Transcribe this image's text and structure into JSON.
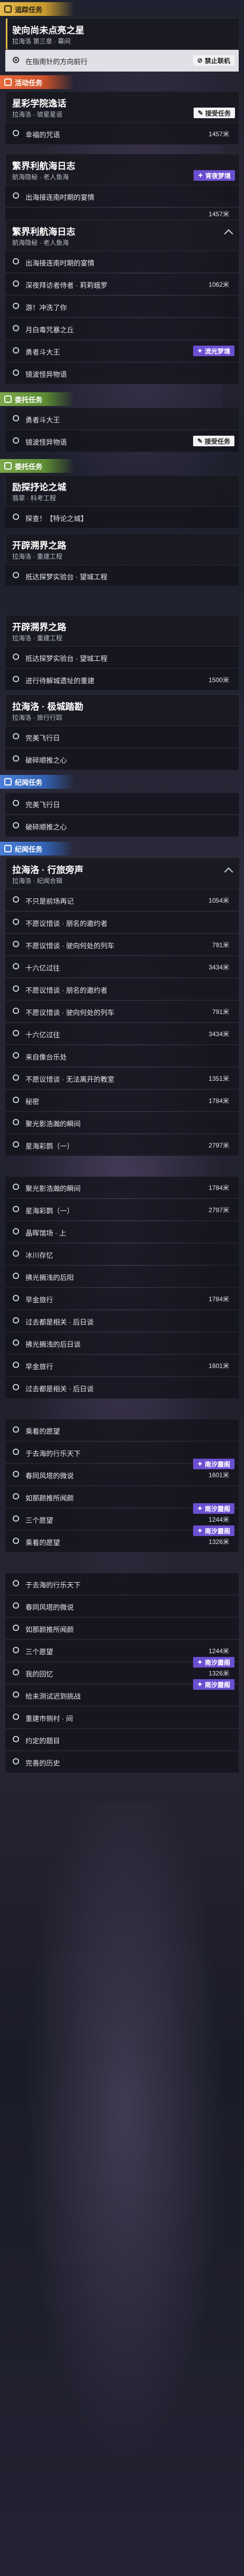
{
  "sections": {
    "tracking": "追踪任务",
    "activity": "活动任务",
    "daily": "委托任务",
    "side": "纪闻任务"
  },
  "badges": {
    "no_coop": "禁止联机",
    "dream_scene": "流光梦境",
    "start_quest": "接受任务",
    "sea_dream": "宵夜梦境",
    "wave": "南汐蜃阁"
  },
  "quests": {
    "q1": {
      "title": "驶向尚未点亮之星",
      "sub": "拉海洛 第三章 · 幕间",
      "steps": [
        "在指南针的方向前行"
      ]
    },
    "q2": {
      "title": "星彩学院逸话",
      "sub": "拉海洛 · 琥星星谣",
      "steps": [
        "幸福的咒语"
      ],
      "dist": [
        "1457米"
      ]
    },
    "q3": {
      "title": "繁界利航海日志",
      "sub": "航海隐秘 · 老人鱼海",
      "steps": [
        "出海接连南时期的宴情"
      ],
      "dist2": "1457米"
    },
    "q4": {
      "title": "繁界利航海日志",
      "sub": "航海隐秘 · 老人鱼海",
      "steps": [
        "出海接连南时期的宴情",
        "深夜拜访者侍者 · 莉莉蛾罗",
        "游！冲洗了你",
        "月白毒咒暴之丘",
        "勇者斗大王",
        "镜波怪异物语"
      ],
      "dist": "1062米"
    },
    "q5": {
      "title": "勇者斗大王",
      "steps2": "镜波怪异物语"
    },
    "q6": {
      "title": "励探抒论之城",
      "sub": "翡翠 · 科考工程",
      "steps": [
        "探查！【特论之城】"
      ]
    },
    "q7": {
      "title": "开辟溯界之路",
      "sub": "拉海洛 · 重建工程",
      "steps": [
        "抵达探梦实验台 · 望城工程"
      ]
    },
    "q8": {
      "title": "开辟溯界之路",
      "sub": "拉海洛 · 重建工程",
      "steps": [
        "抵达探梦实验台 · 望城工程",
        "进行待解城遗址的重建"
      ],
      "dist": "1500米"
    },
    "q9": {
      "title": "拉海洛 · 极城踏勘",
      "sub": "拉海洛 · 旅行行踪",
      "steps": [
        "完美飞行日",
        "破碎顺推之心"
      ]
    },
    "q10": {
      "title": "拉海洛 · 行旅旁声",
      "sub": "拉海洛 · 纪闻合辑",
      "steps": [
        "不只是前场再记",
        "不愿议惜谈 · 朋名的邀约者",
        "不愿议惜谈 · 驶向何处的列车",
        "十六亿过往",
        "不愿议惜谈 · 朋名的邀约者",
        "不愿议惜谈 · 驶向何处的列车",
        "十六亿过往",
        "来自像台乐处",
        "不愿议惜谈 · 无法离开的教室",
        "秘密",
        "聚光影浩瀚的瞬间",
        "星海彩鹊（一）",
        "聚光影浩瀚的瞬间",
        "星海彩鹊（一）",
        "晶晖馆场 · 上",
        "冰川存忆",
        "拂光搁浅的后阳",
        "早金旅行",
        "过去都是相关 · 后日谈",
        "拂光搁浅的后日谈",
        "早金旅行",
        "过去都是相关 · 后日谈",
        "乘着的愿望",
        "于去海的行乐天下",
        "春同风塔的微说",
        "如那颜推所闻颜",
        "三个愿望",
        "乘着的愿望",
        "于去海的行乐天下",
        "春同风塔的微说",
        "如那颜推所闻颜",
        "三个愿望",
        "我的回忆",
        "给未测试迟到挑战",
        "重建市侧村 · 间",
        "约定的题目",
        "完善的历史"
      ],
      "dists": [
        "1054米",
        "791米",
        "3434米",
        "791米",
        "3434米",
        "1351米",
        "1784米",
        "2797米",
        "1784米",
        "2797米",
        "1784米",
        "1601米",
        "1601米",
        "1244米",
        "1326米",
        "1244米",
        "1326米"
      ]
    }
  }
}
